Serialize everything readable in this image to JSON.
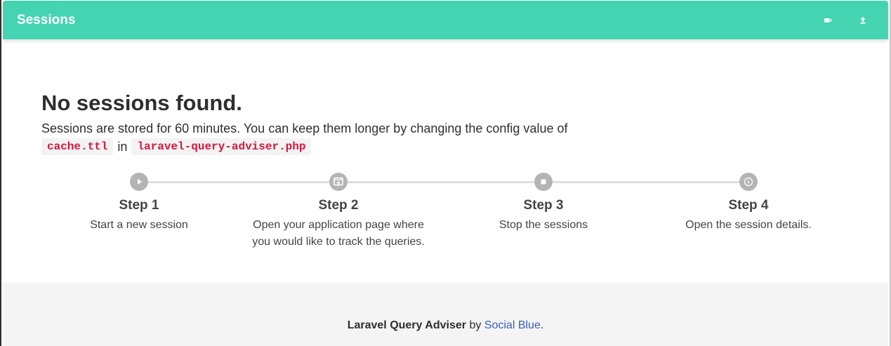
{
  "header": {
    "title": "Sessions",
    "buttons": [
      {
        "icon": "coffee-icon"
      },
      {
        "icon": "upload-icon"
      }
    ],
    "color": "#44d4b2"
  },
  "empty_state": {
    "heading": "No sessions found.",
    "description": "Sessions are stored for 60 minutes. You can keep them longer by changing the config value of",
    "config_key": "cache.ttl",
    "in_word": "in",
    "config_file": "laravel-query-adviser.php"
  },
  "steps": [
    {
      "icon": "play-icon",
      "title": "Step 1",
      "text": "Start a new session"
    },
    {
      "icon": "open-page-icon",
      "title": "Step 2",
      "text": "Open your application page where you would like to track the queries."
    },
    {
      "icon": "stop-icon",
      "title": "Step 3",
      "text": "Stop the sessions"
    },
    {
      "icon": "info-icon",
      "title": "Step 4",
      "text": "Open the session details."
    }
  ],
  "footer": {
    "product": "Laravel Query Adviser",
    "by": "by",
    "author": "Social Blue",
    "period": "."
  }
}
